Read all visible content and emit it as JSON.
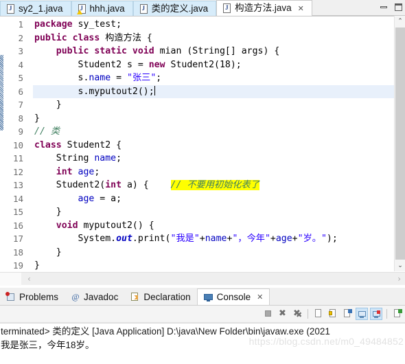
{
  "window": {
    "minimize_label": "minimize",
    "maximize_label": "maximize"
  },
  "editor_tabs": [
    {
      "label": "sy2_1.java",
      "icon": "java-file-icon",
      "active": false,
      "warning": false
    },
    {
      "label": "hhh.java",
      "icon": "java-file-icon",
      "active": false,
      "warning": true
    },
    {
      "label": "类的定义.java",
      "icon": "java-file-icon",
      "active": false,
      "warning": false
    },
    {
      "label": "构造方法.java",
      "icon": "java-file-icon",
      "active": true,
      "warning": false,
      "close": "✕"
    }
  ],
  "code": {
    "lines": [
      {
        "n": "1",
        "fold": false,
        "current": false
      },
      {
        "n": "2",
        "fold": false,
        "current": false
      },
      {
        "n": "3",
        "fold": true,
        "current": false
      },
      {
        "n": "4",
        "fold": false,
        "current": false
      },
      {
        "n": "5",
        "fold": false,
        "current": false
      },
      {
        "n": "6",
        "fold": false,
        "current": true
      },
      {
        "n": "7",
        "fold": false,
        "current": false
      },
      {
        "n": "8",
        "fold": false,
        "current": false
      },
      {
        "n": "9",
        "fold": false,
        "current": false
      },
      {
        "n": "10",
        "fold": false,
        "current": false
      },
      {
        "n": "11",
        "fold": false,
        "current": false
      },
      {
        "n": "12",
        "fold": false,
        "current": false
      },
      {
        "n": "13",
        "fold": true,
        "current": false
      },
      {
        "n": "14",
        "fold": false,
        "current": false
      },
      {
        "n": "15",
        "fold": false,
        "current": false
      },
      {
        "n": "16",
        "fold": true,
        "current": false
      },
      {
        "n": "17",
        "fold": false,
        "current": false
      },
      {
        "n": "18",
        "fold": false,
        "current": false
      },
      {
        "n": "19",
        "fold": false,
        "current": false
      }
    ],
    "text": [
      "package sy_test;",
      "public class 构造方法 {",
      "    public static void mian (String[] args) {",
      "        Student2 s = new Student2(18);",
      "        s.name = \"张三\";",
      "        s.myputout2();",
      "    }",
      "}",
      "// 类",
      "class Student2 {",
      "    String name;",
      "    int age;",
      "    Student2(int a) {    // 不要用初始化表了",
      "        age = a;",
      "    }",
      "    void myputout2() {",
      "        System.out.print(\"我是\"+name+\"，今年\"+age+\"岁。\");",
      "    }",
      "}"
    ],
    "highlight_comment": "// 不要用初始化表了",
    "colors": {
      "keyword": "#7f0055",
      "string": "#2a00ff",
      "field": "#0000c0",
      "comment": "#3f7f5f",
      "comment_highlight_bg": "#ffff00",
      "current_line_bg": "#e8f0fb"
    }
  },
  "view_tabs": [
    {
      "label": "Problems",
      "icon": "problems-icon",
      "active": false
    },
    {
      "label": "Javadoc",
      "icon": "javadoc-icon",
      "active": false
    },
    {
      "label": "Declaration",
      "icon": "declaration-icon",
      "active": false
    },
    {
      "label": "Console",
      "icon": "console-icon",
      "active": true,
      "close": "✕"
    }
  ],
  "console_toolbar": [
    {
      "name": "terminate-button",
      "state": "off"
    },
    {
      "name": "remove-launch-button",
      "state": "off"
    },
    {
      "name": "remove-all-terminated-button",
      "state": "off"
    },
    {
      "name": "open-console-button",
      "state": "off"
    },
    {
      "name": "scroll-lock-button",
      "state": "off"
    },
    {
      "name": "word-wrap-button",
      "state": "off"
    },
    {
      "name": "show-console-on-output-button",
      "state": "on"
    },
    {
      "name": "pin-console-button",
      "state": "on"
    },
    {
      "name": "new-console-view-button",
      "state": "off"
    }
  ],
  "console": {
    "status_line": "terminated> 类的定义 [Java Application] D:\\java\\New Folder\\bin\\javaw.exe  (2021",
    "output_line": "我是张三，今年18岁。",
    "watermark": "https://blog.csdn.net/m0_49484852"
  },
  "scrollbars": {
    "vertical_up": "⌃",
    "vertical_down": "⌄",
    "horizontal_left": "‹",
    "horizontal_right": "›"
  }
}
